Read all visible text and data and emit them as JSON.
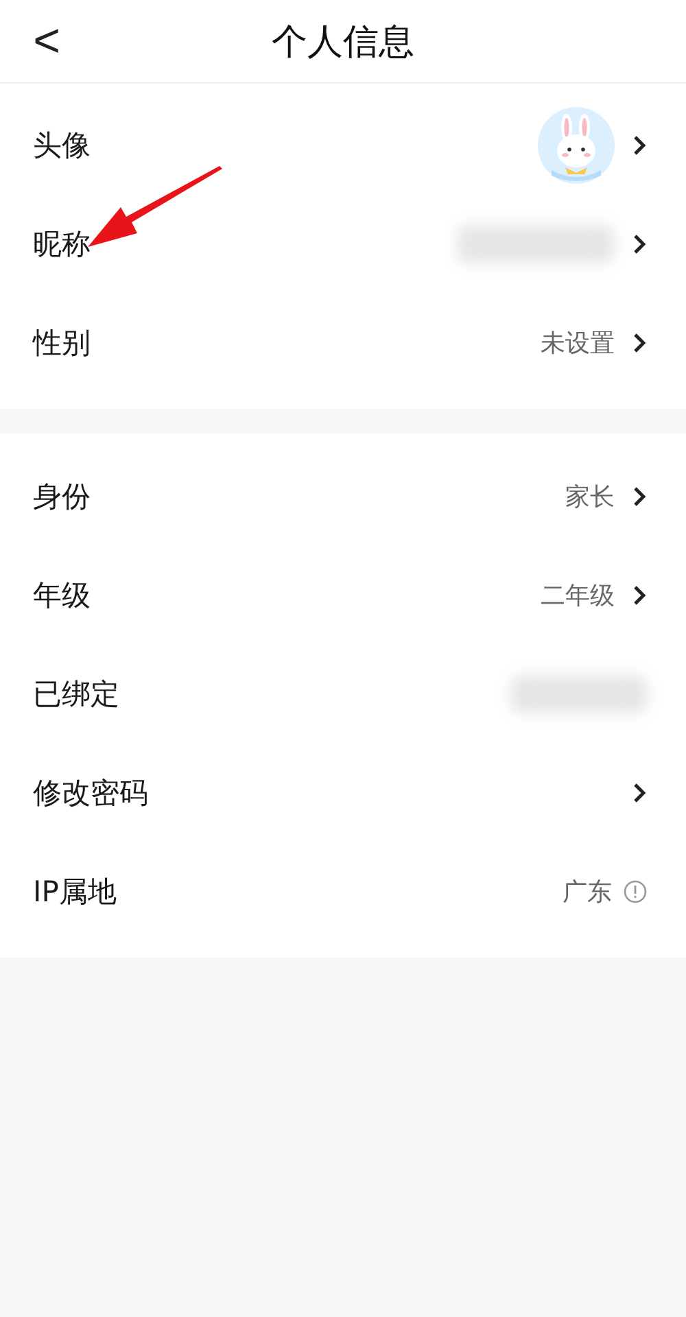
{
  "header": {
    "back": "<",
    "title": "个人信息"
  },
  "sections": [
    {
      "rows": [
        {
          "label": "头像",
          "kind": "avatar",
          "chevron": true
        },
        {
          "label": "昵称",
          "kind": "hidden",
          "chevron": true,
          "annotated": true
        },
        {
          "label": "性别",
          "kind": "text",
          "value": "未设置",
          "chevron": true
        }
      ]
    },
    {
      "rows": [
        {
          "label": "身份",
          "kind": "text",
          "value": "家长",
          "chevron": true
        },
        {
          "label": "年级",
          "kind": "text",
          "value": "二年级",
          "chevron": true
        },
        {
          "label": "已绑定",
          "kind": "hidden",
          "chevron": false
        },
        {
          "label": "修改密码",
          "kind": "none",
          "chevron": true
        },
        {
          "label": "IP属地",
          "kind": "info",
          "value": "广东",
          "chevron": false
        }
      ]
    }
  ]
}
